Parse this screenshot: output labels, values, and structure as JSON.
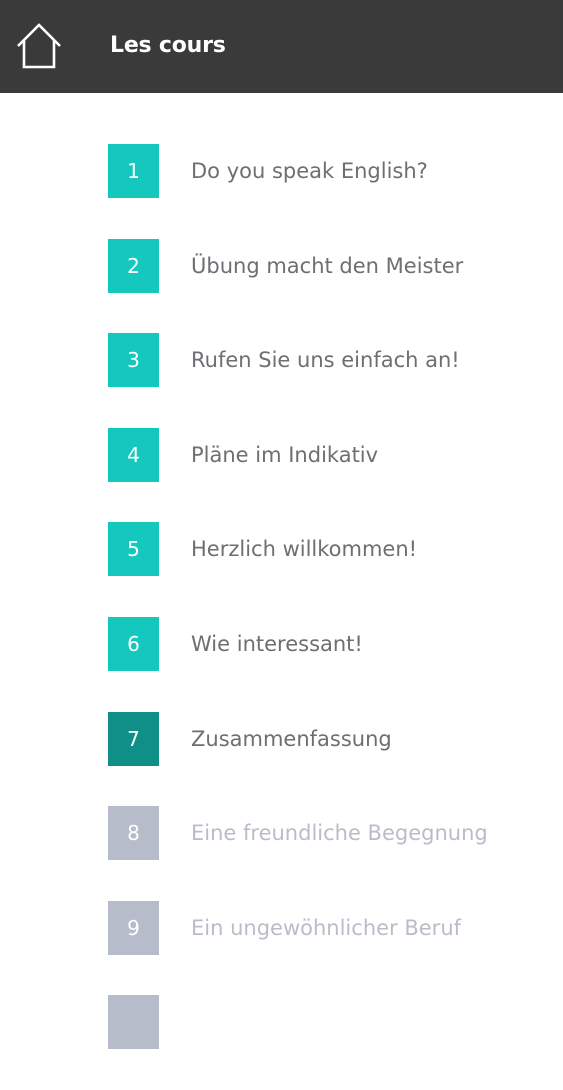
{
  "header": {
    "title": "Les cours",
    "home_icon": "home-icon"
  },
  "colors": {
    "header_bg": "#3b3a3b",
    "completed": "#14c8bd",
    "current": "#0f8f88",
    "locked": "#b6bcc9",
    "text": "#6e6e73",
    "text_locked": "#b9bdc8"
  },
  "lessons": [
    {
      "number": "1",
      "title": "Do you speak English?",
      "status": "completed"
    },
    {
      "number": "2",
      "title": "Übung macht den Meister",
      "status": "completed"
    },
    {
      "number": "3",
      "title": "Rufen Sie uns einfach an!",
      "status": "completed"
    },
    {
      "number": "4",
      "title": "Pläne im Indikativ",
      "status": "completed"
    },
    {
      "number": "5",
      "title": "Herzlich willkommen!",
      "status": "completed"
    },
    {
      "number": "6",
      "title": "Wie interessant!",
      "status": "completed"
    },
    {
      "number": "7",
      "title": "Zusammenfassung",
      "status": "current"
    },
    {
      "number": "8",
      "title": "Eine freundliche Begegnung",
      "status": "locked"
    },
    {
      "number": "9",
      "title": "Ein ungewöhnlicher Beruf",
      "status": "locked"
    },
    {
      "number": "",
      "title": "",
      "status": "locked"
    }
  ]
}
